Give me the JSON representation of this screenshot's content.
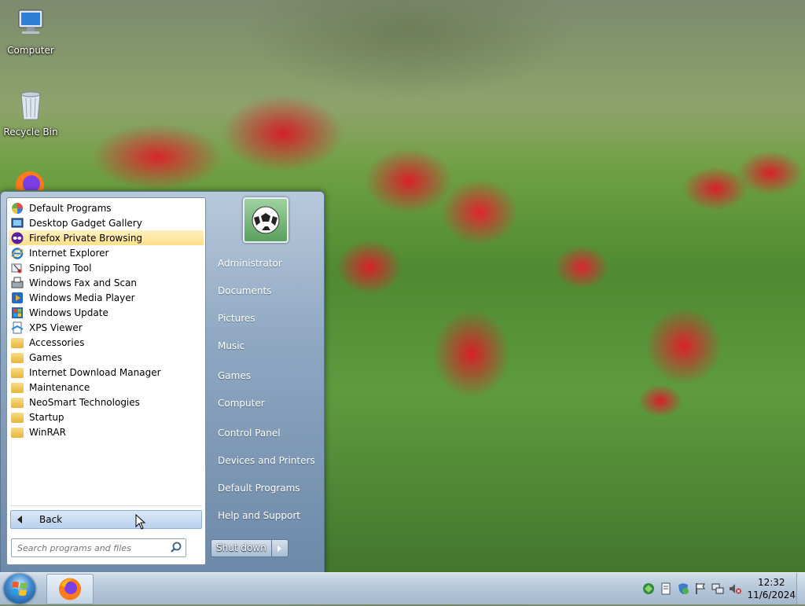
{
  "desktop": {
    "icons": [
      {
        "label": "Computer",
        "icon": "computer-icon"
      },
      {
        "label": "Recycle Bin",
        "icon": "recycle-bin-icon"
      }
    ]
  },
  "start_menu": {
    "programs": [
      {
        "label": "Default Programs",
        "icon": "default-programs-icon"
      },
      {
        "label": "Desktop Gadget Gallery",
        "icon": "gadget-gallery-icon"
      },
      {
        "label": "Firefox Private Browsing",
        "icon": "firefox-private-icon",
        "highlighted": true
      },
      {
        "label": "Internet Explorer",
        "icon": "internet-explorer-icon"
      },
      {
        "label": "Snipping Tool",
        "icon": "snipping-tool-icon"
      },
      {
        "label": "Windows Fax and Scan",
        "icon": "fax-scan-icon"
      },
      {
        "label": "Windows Media Player",
        "icon": "media-player-icon"
      },
      {
        "label": "Windows Update",
        "icon": "windows-update-icon"
      },
      {
        "label": "XPS Viewer",
        "icon": "xps-viewer-icon"
      },
      {
        "label": "Accessories",
        "icon": "folder-icon"
      },
      {
        "label": "Games",
        "icon": "folder-icon"
      },
      {
        "label": "Internet Download Manager",
        "icon": "folder-icon"
      },
      {
        "label": "Maintenance",
        "icon": "folder-icon"
      },
      {
        "label": "NeoSmart Technologies",
        "icon": "folder-icon"
      },
      {
        "label": "Startup",
        "icon": "folder-icon"
      },
      {
        "label": "WinRAR",
        "icon": "folder-icon"
      }
    ],
    "back_label": "Back",
    "search_placeholder": "Search programs and files",
    "right_links": [
      "Administrator",
      "Documents",
      "Pictures",
      "Music",
      "Games",
      "Computer",
      "Control Panel",
      "Devices and Printers",
      "Default Programs",
      "Help and Support"
    ],
    "shutdown_label": "Shut down"
  },
  "taskbar": {
    "pinned": [
      "firefox-icon"
    ],
    "tray_icons": [
      "network-icon",
      "document-icon",
      "security-icon",
      "action-center-flag-icon",
      "network-connection-icon",
      "volume-muted-icon"
    ],
    "time": "12:32",
    "date": "11/6/2024"
  },
  "colors": {
    "highlight": "#ffe08a",
    "start_menu_right": "#8ea7c1",
    "taskbar": "#b6c8da"
  }
}
